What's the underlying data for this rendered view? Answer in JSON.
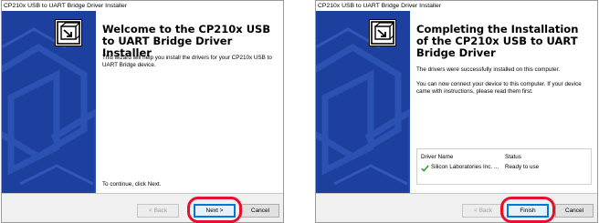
{
  "welcome": {
    "title": "CP210x USB to UART Bridge Driver Installer",
    "heading": "Welcome to the CP210x USB to UART Bridge Driver Installer",
    "description": "This wizard will help you install the drivers for your CP210x USB to UART Bridge device.",
    "continue_text": "To continue, click Next.",
    "back_label": "< Back",
    "next_label": "Next >",
    "cancel_label": "Cancel"
  },
  "complete": {
    "title": "CP210x USB to UART Bridge Driver Installer",
    "heading": "Completing the Installation of the CP210x USB to UART Bridge Driver",
    "success_text": "The drivers were successfully installed on this computer.",
    "connect_text": "You can now connect your device to this computer. If your device came with instructions, please read them first.",
    "table": {
      "columns": [
        "Driver Name",
        "Status"
      ],
      "rows": [
        {
          "name": "Silicon Laboratories Inc. ...",
          "status": "Ready to use"
        }
      ]
    },
    "back_label": "< Back",
    "finish_label": "Finish",
    "cancel_label": "Cancel"
  },
  "colors": {
    "banner": "#1d3f9e",
    "highlight": "#e4102c",
    "default_button": "#0078d7",
    "check": "#2e9b2e"
  }
}
